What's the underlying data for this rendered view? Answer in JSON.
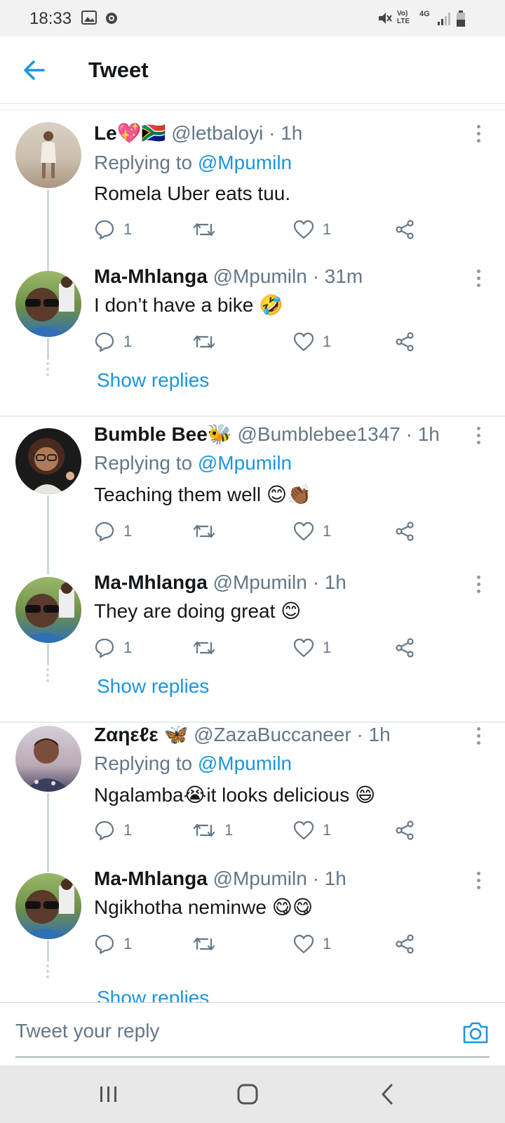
{
  "status_bar": {
    "time": "18:33",
    "signal_text_1": "Vo) LTE",
    "signal_text_2": "4G"
  },
  "header": {
    "title": "Tweet"
  },
  "tweets": [
    {
      "name": "Le💖🇿🇦",
      "handle": "@letbaloyi",
      "time": "· 1h",
      "replying_prefix": "Replying to ",
      "replying_to": "@Mpumiln",
      "text": "Romela Uber eats tuu.",
      "replies": "1",
      "retweets": "",
      "likes": "1"
    },
    {
      "name": "Ma-Mhlanga",
      "handle": "@Mpumiln",
      "time": "· 31m",
      "text": "I don’t have a bike 🤣",
      "replies": "1",
      "retweets": "",
      "likes": "1"
    },
    {
      "name": "Bumble Bee🐝",
      "handle": "@Bumblebee1347",
      "time": "· 1h",
      "replying_prefix": "Replying to ",
      "replying_to": "@Mpumiln",
      "text": "Teaching them well 😊👏🏾",
      "replies": "1",
      "retweets": "",
      "likes": "1"
    },
    {
      "name": "Ma-Mhlanga",
      "handle": "@Mpumiln",
      "time": "· 1h",
      "text": "They are doing great 😊",
      "replies": "1",
      "retweets": "",
      "likes": "1"
    },
    {
      "name": "Ζαηεℓε 🦋",
      "handle": "@ZazaBuccaneer",
      "time": "· 1h",
      "replying_prefix": "Replying to ",
      "replying_to": "@Mpumiln",
      "text": "Ngalamba😭it looks delicious 😄",
      "replies": "1",
      "retweets": "1",
      "likes": "1"
    },
    {
      "name": "Ma-Mhlanga",
      "handle": "@Mpumiln",
      "time": "· 1h",
      "text": "Ngikhotha neminwe 😋😋",
      "replies": "1",
      "retweets": "",
      "likes": "1"
    }
  ],
  "show_replies_label": "Show replies",
  "reply_bar": {
    "placeholder": "Tweet your reply"
  },
  "colors": {
    "accent": "#1b95e0",
    "secondary_text": "#657786",
    "thread_line": "#ccd6dd"
  },
  "icons": [
    "back-arrow-icon",
    "reply-icon",
    "retweet-icon",
    "like-icon",
    "share-icon",
    "more-icon",
    "camera-icon",
    "recent-apps-icon",
    "home-icon",
    "back-nav-icon"
  ]
}
